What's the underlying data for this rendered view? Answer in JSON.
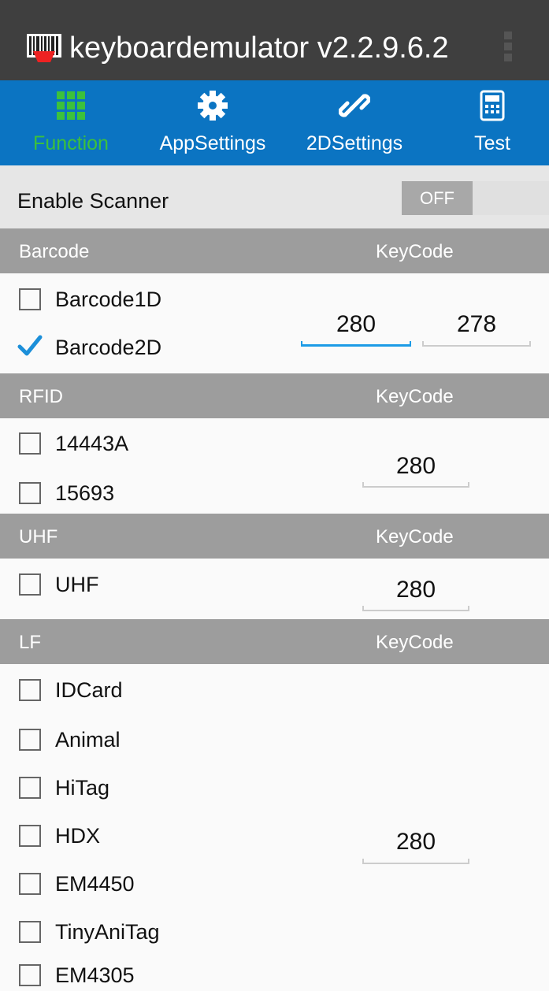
{
  "app": {
    "title": "keyboardemulator v2.2.9.6.2"
  },
  "tabs": [
    {
      "label": "Function",
      "icon": "grid-icon",
      "active": true
    },
    {
      "label": "AppSettings",
      "icon": "gear-icon"
    },
    {
      "label": "2DSettings",
      "icon": "link-icon"
    },
    {
      "label": "Test",
      "icon": "calculator-icon"
    }
  ],
  "enable": {
    "label": "Enable Scanner",
    "toggle_state": "OFF"
  },
  "sections": {
    "barcode": {
      "title": "Barcode",
      "keycode_label": "KeyCode",
      "items": [
        "Barcode1D",
        "Barcode2D"
      ],
      "checked": [
        false,
        true
      ],
      "keycode1": "280",
      "keycode2": "278"
    },
    "rfid": {
      "title": "RFID",
      "keycode_label": "KeyCode",
      "items": [
        "14443A",
        "15693"
      ],
      "keycode": "280"
    },
    "uhf": {
      "title": "UHF",
      "keycode_label": "KeyCode",
      "items": [
        "UHF"
      ],
      "keycode": "280"
    },
    "lf": {
      "title": "LF",
      "keycode_label": "KeyCode",
      "items": [
        "IDCard",
        "Animal",
        "HiTag",
        "HDX",
        "EM4450",
        "TinyAniTag",
        "EM4305"
      ],
      "keycode": "280"
    }
  },
  "colors": {
    "appbar": "#3f3f3f",
    "tabbar": "#0b74c2",
    "active_tab": "#3cc13c",
    "section": "#9d9d9d",
    "focus": "#1c9be6"
  }
}
